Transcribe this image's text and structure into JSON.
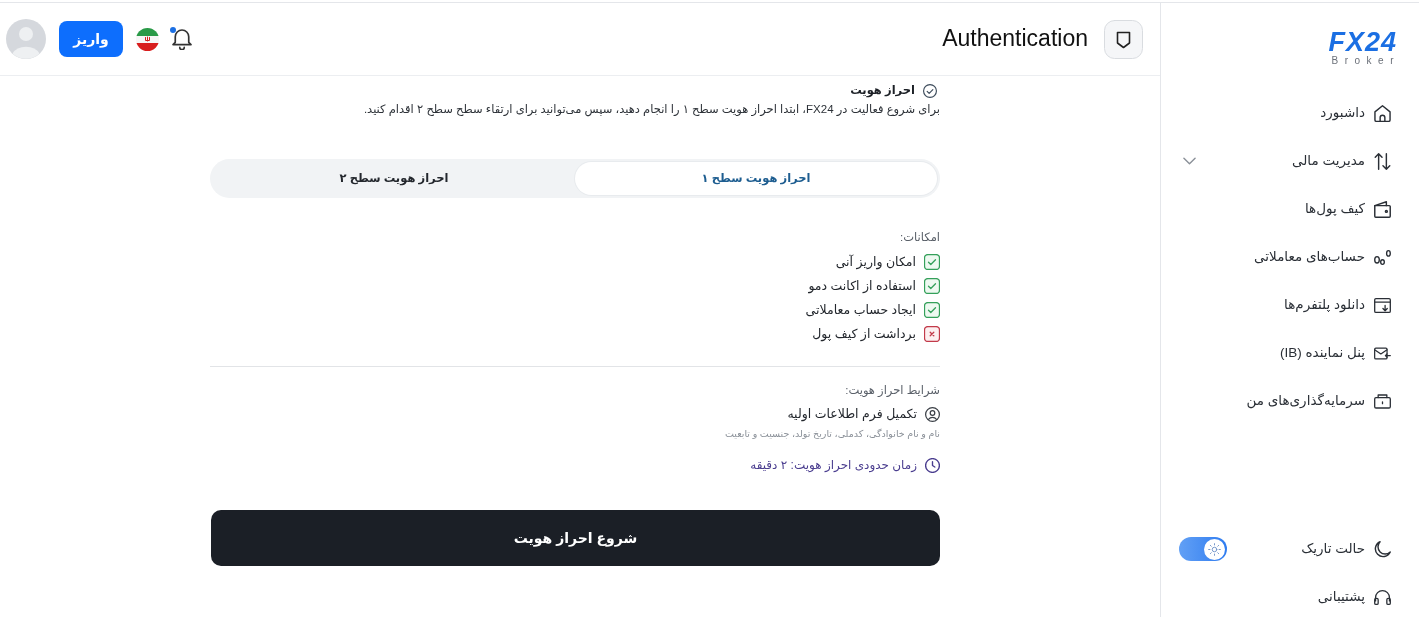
{
  "sidebar": {
    "logo": {
      "title": "FX24",
      "tagline": "Broker"
    },
    "items": [
      {
        "kind": "link",
        "label": "داشبورد"
      },
      {
        "kind": "menu",
        "label": "مدیریت مالی",
        "expanded": false
      },
      {
        "kind": "link",
        "label": "کیف پول‌ها"
      },
      {
        "kind": "link",
        "label": "حساب‌های معاملاتی"
      },
      {
        "kind": "link",
        "label": "دانلود پلتفرم‌ها"
      },
      {
        "kind": "link",
        "label": "پنل نماینده (IB)"
      },
      {
        "kind": "link",
        "label": "سرمایه‌گذاری‌های من"
      }
    ],
    "footer": [
      {
        "kind": "toggle",
        "label": "حالت تاریک",
        "on": true
      },
      {
        "kind": "link",
        "label": "پشتیبانی"
      }
    ]
  },
  "header": {
    "title": "Authentication",
    "notifications_unread": true,
    "deposit_button": "واریز"
  },
  "intro": {
    "title": "احراز هویت",
    "text": "برای شروع فعالیت در FX24، ابتدا احراز هویت سطح ۱ را انجام دهید، سپس می‌توانید برای ارتقاء سطح سطح ۲ اقدام کنید."
  },
  "tabs": [
    {
      "label": "احراز هویت سطح ۱",
      "selected": true
    },
    {
      "label": "احراز هویت سطح ۲",
      "selected": false
    }
  ],
  "features": {
    "heading": "امکانات:",
    "items": [
      {
        "label": "امکان واریز آنی",
        "available": true
      },
      {
        "label": "استفاده از اکانت دمو",
        "available": true
      },
      {
        "label": "ایجاد حساب معاملاتی",
        "available": true
      },
      {
        "label": "برداشت از کیف پول",
        "available": false
      }
    ]
  },
  "requirements": {
    "heading": "شرایط احراز هویت:",
    "items": [
      {
        "title": "تکمیل فرم اطلاعات اولیه",
        "detail": "نام و نام خانوادگی، کدملی، تاریخ تولد، جنسیت و تابعیت"
      }
    ],
    "duration": "زمان حدودی احراز هویت: ۲ دقیقه"
  },
  "start_button": "شروع احراز هویت"
}
